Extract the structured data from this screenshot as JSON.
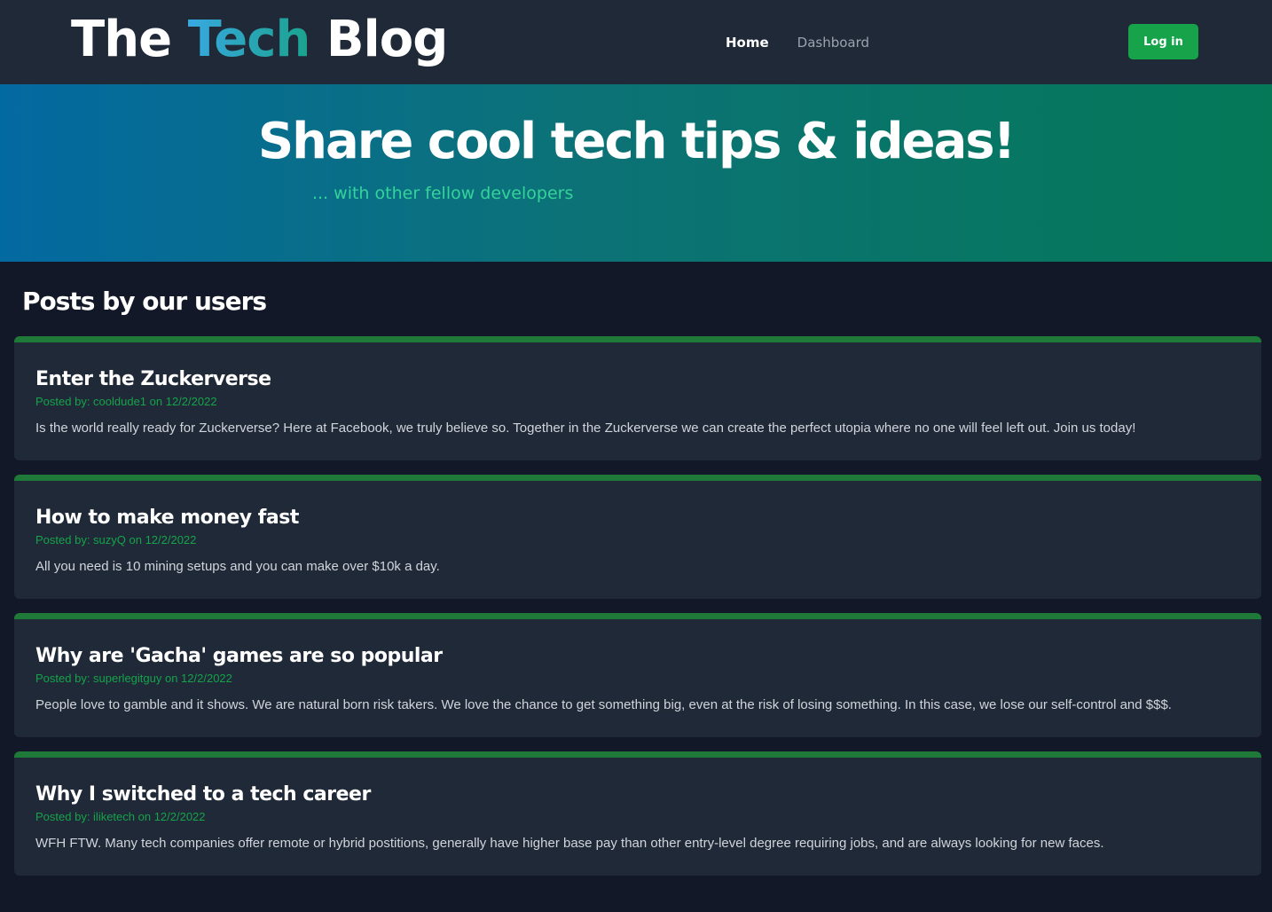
{
  "header": {
    "logo_part1": "The ",
    "logo_part2": "Tech",
    "logo_part3": " Blog",
    "nav": [
      {
        "label": "Home"
      },
      {
        "label": "Dashboard"
      }
    ],
    "login_label": "Log in"
  },
  "hero": {
    "title": "Share cool tech tips & ideas!",
    "subtitle": "... with other fellow developers"
  },
  "posts_heading": "Posts by our users",
  "posts": [
    {
      "title": "Enter the Zuckerverse",
      "meta": "Posted by: cooldude1 on 12/2/2022",
      "body": "Is the world really ready for Zuckerverse? Here at Facebook, we truly believe so. Together in the Zuckerverse we can create the perfect utopia where no one will feel left out. Join us today!"
    },
    {
      "title": "How to make money fast",
      "meta": "Posted by: suzyQ on 12/2/2022",
      "body": "All you need is 10 mining setups and you can make over $10k a day."
    },
    {
      "title": "Why are 'Gacha' games are so popular",
      "meta": "Posted by: superlegitguy on 12/2/2022",
      "body": "People love to gamble and it shows. We are natural born risk takers. We love the chance to get something big, even at the risk of losing something. In this case, we lose our self-control and $$$."
    },
    {
      "title": "Why I switched to a tech career",
      "meta": "Posted by: iliketech on 12/2/2022",
      "body": "WFH FTW. Many tech companies offer remote or hybrid postitions, generally have higher base pay than other entry-level degree requiring jobs, and are always looking for new faces."
    }
  ],
  "colors": {
    "accent_green": "#16a34a",
    "card_border": "#1f7a3a",
    "page_bg": "#121827",
    "header_bg": "#1f2937"
  }
}
